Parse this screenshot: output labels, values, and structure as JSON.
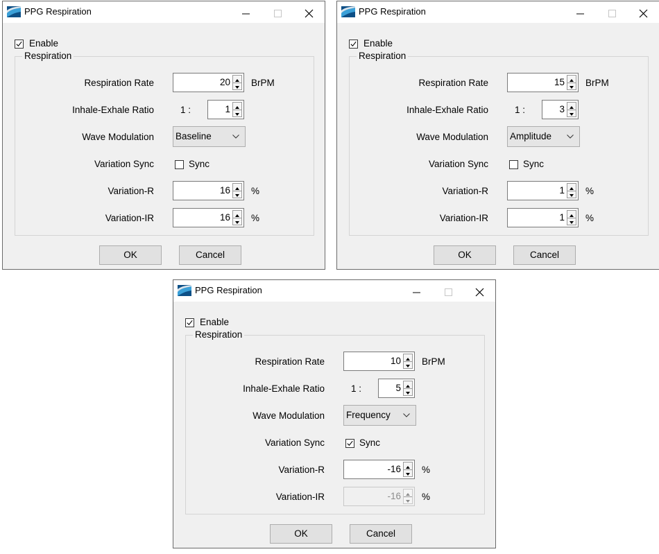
{
  "colors": {
    "icon_dark": "#0d4f86",
    "icon_light": "#3aa0d8",
    "window_bg": "#f0f0f0"
  },
  "icons": {
    "app": "ppg-app-icon",
    "minimize": "minimize-icon",
    "maximize": "maximize-icon",
    "close": "close-icon",
    "check": "checkmark-icon",
    "chevron": "chevron-down-icon"
  },
  "dialogs": [
    {
      "title": "PPG Respiration",
      "enable": {
        "label": "Enable",
        "checked": true
      },
      "group_label": "Respiration",
      "respiration_rate": {
        "label": "Respiration Rate",
        "value": "20",
        "unit": "BrPM"
      },
      "ratio": {
        "label": "Inhale-Exhale Ratio",
        "prefix": "1 :",
        "value": "1"
      },
      "wave_modulation": {
        "label": "Wave Modulation",
        "value": "Baseline"
      },
      "variation_sync": {
        "label": "Variation Sync",
        "checkbox_label": "Sync",
        "checked": false
      },
      "variation_r": {
        "label": "Variation-R",
        "value": "16",
        "unit": "%"
      },
      "variation_ir": {
        "label": "Variation-IR",
        "value": "16",
        "unit": "%",
        "disabled": false
      },
      "ok_label": "OK",
      "cancel_label": "Cancel"
    },
    {
      "title": "PPG Respiration",
      "enable": {
        "label": "Enable",
        "checked": true
      },
      "group_label": "Respiration",
      "respiration_rate": {
        "label": "Respiration Rate",
        "value": "15",
        "unit": "BrPM"
      },
      "ratio": {
        "label": "Inhale-Exhale Ratio",
        "prefix": "1 :",
        "value": "3"
      },
      "wave_modulation": {
        "label": "Wave Modulation",
        "value": "Amplitude"
      },
      "variation_sync": {
        "label": "Variation Sync",
        "checkbox_label": "Sync",
        "checked": false
      },
      "variation_r": {
        "label": "Variation-R",
        "value": "1",
        "unit": "%"
      },
      "variation_ir": {
        "label": "Variation-IR",
        "value": "1",
        "unit": "%",
        "disabled": false
      },
      "ok_label": "OK",
      "cancel_label": "Cancel"
    },
    {
      "title": "PPG Respiration",
      "enable": {
        "label": "Enable",
        "checked": true
      },
      "group_label": "Respiration",
      "respiration_rate": {
        "label": "Respiration Rate",
        "value": "10",
        "unit": "BrPM"
      },
      "ratio": {
        "label": "Inhale-Exhale Ratio",
        "prefix": "1 :",
        "value": "5"
      },
      "wave_modulation": {
        "label": "Wave Modulation",
        "value": "Frequency"
      },
      "variation_sync": {
        "label": "Variation Sync",
        "checkbox_label": "Sync",
        "checked": true
      },
      "variation_r": {
        "label": "Variation-R",
        "value": "-16",
        "unit": "%"
      },
      "variation_ir": {
        "label": "Variation-IR",
        "value": "-16",
        "unit": "%",
        "disabled": true
      },
      "ok_label": "OK",
      "cancel_label": "Cancel"
    }
  ]
}
